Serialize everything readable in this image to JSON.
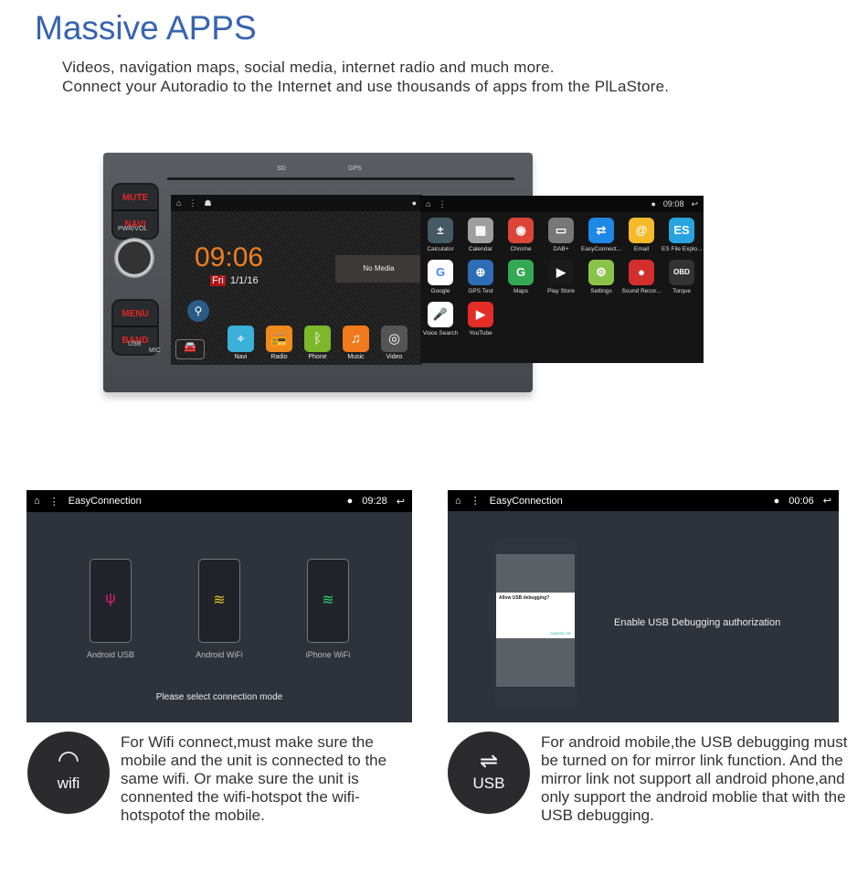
{
  "header": {
    "title": "Massive APPS",
    "lines": [
      "Videos, navigation maps, social media, internet radio and much more.",
      "Connect your Autoradio to the Internet and use thousands of apps from the PlLaStore."
    ]
  },
  "head_unit": {
    "top_labels": [
      "SD",
      "GPS"
    ],
    "buttons": [
      [
        "MUTE",
        "NAVI"
      ],
      [
        "MENU",
        "BAND"
      ]
    ],
    "pwr_label": "PWR/VOL",
    "usb_label": "USB",
    "mic_label": "MIC"
  },
  "home_screen": {
    "time": "09:06",
    "day": "Fri",
    "date": "1/1/16",
    "media": "No Media",
    "dock": [
      {
        "label": "Navi",
        "color": "#3bb0d8"
      },
      {
        "label": "Radio",
        "color": "#f08a1e"
      },
      {
        "label": "Phone",
        "color": "#7cb82a"
      },
      {
        "label": "Music",
        "color": "#f07a1c"
      },
      {
        "label": "Video",
        "color": "#555"
      }
    ]
  },
  "apps_screen": {
    "time": "09:08",
    "apps": [
      {
        "label": "Calculator",
        "color": "#455a64",
        "glyph": "±"
      },
      {
        "label": "Calendar",
        "color": "#9e9e9e",
        "glyph": "▦"
      },
      {
        "label": "Chrome",
        "color": "#db4437",
        "glyph": "◉"
      },
      {
        "label": "DAB+",
        "color": "#777",
        "glyph": "▭"
      },
      {
        "label": "EasyConnect...",
        "color": "#1e88e5",
        "glyph": "⇄"
      },
      {
        "label": "Email",
        "color": "#f6b92b",
        "glyph": "@"
      },
      {
        "label": "ES File Explo...",
        "color": "#29a3e0",
        "glyph": "ES"
      },
      {
        "label": "Google",
        "color": "#ffffff",
        "glyph": "G"
      },
      {
        "label": "GPS Test",
        "color": "#2c6db5",
        "glyph": "⊕"
      },
      {
        "label": "Maps",
        "color": "#34a853",
        "glyph": "G"
      },
      {
        "label": "Play Store",
        "color": "#1a1a1a",
        "glyph": "▶"
      },
      {
        "label": "Settings",
        "color": "#8bc34a",
        "glyph": "⚙"
      },
      {
        "label": "Sound Recor...",
        "color": "#d32f2f",
        "glyph": "●"
      },
      {
        "label": "Torque",
        "color": "#333",
        "glyph": "OBD"
      },
      {
        "label": "Voice Search",
        "color": "#ffffff",
        "glyph": "🎤"
      },
      {
        "label": "YouTube",
        "color": "#e52d27",
        "glyph": "▶"
      }
    ]
  },
  "wifi_panel": {
    "app": "EasyConnection",
    "time": "09:28",
    "modes": [
      {
        "label": "Android USB",
        "color": "#e0207a",
        "glyph": "ψ"
      },
      {
        "label": "Android WiFi",
        "color": "#e0c020",
        "glyph": "◠"
      },
      {
        "label": "iPhone WiFi",
        "color": "#2ecc71",
        "glyph": "◠"
      }
    ],
    "prompt": "Please select connection mode"
  },
  "usb_panel": {
    "app": "EasyConnection",
    "time": "00:06",
    "dialog_title": "Allow USB debugging?",
    "dialog_cancel": "CANCEL",
    "dialog_ok": "OK",
    "caption": "Enable USB Debugging authorization"
  },
  "wifi_info": {
    "badge": "wifi",
    "text": "For Wifi connect,must make sure the mobile and the unit is connected to the same wifi. Or make sure the unit is connented the wifi-hotspot the wifi-hotspotof the mobile."
  },
  "usb_info": {
    "badge": "USB",
    "text": "For android mobile,the USB debugging must be turned on for mirror link function. And the mirror link not support all android phone,and only support the android moblie that with the USB debugging."
  }
}
